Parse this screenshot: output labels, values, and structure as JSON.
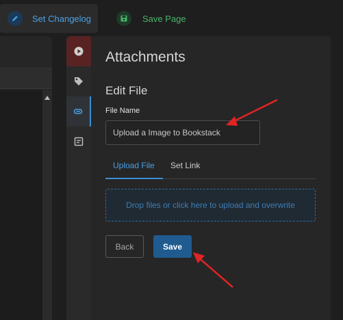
{
  "toolbar": {
    "changelog_label": "Set Changelog",
    "save_page_label": "Save Page"
  },
  "sidebar_tabs": [
    {
      "icon": "play-icon"
    },
    {
      "icon": "tag-icon"
    },
    {
      "icon": "attachment-icon"
    },
    {
      "icon": "template-icon"
    }
  ],
  "attachments": {
    "title": "Attachments",
    "edit_title": "Edit File",
    "file_name_label": "File Name",
    "file_name_value": "Upload a Image to Bookstack",
    "tabs": {
      "upload": "Upload File",
      "link": "Set Link"
    },
    "dropzone_text": "Drop files or click here to upload and overwrite",
    "back_label": "Back",
    "save_label": "Save"
  },
  "colors": {
    "accent": "#3a8fd6",
    "save_green": "#46b46a",
    "annotation_red": "#e02424"
  }
}
